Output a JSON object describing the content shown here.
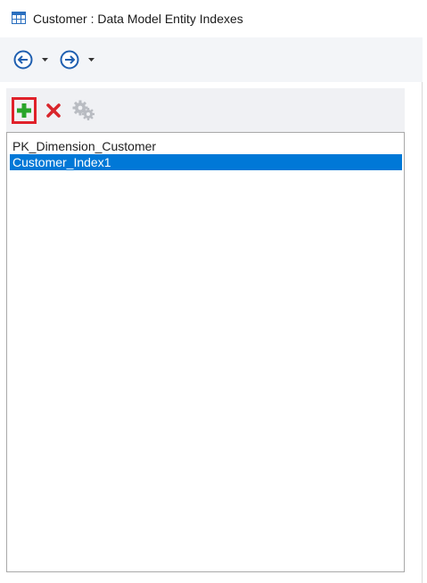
{
  "window": {
    "title": "Customer : Data Model Entity Indexes",
    "title_icon": "table-icon"
  },
  "navigation": {
    "back_icon": "arrow-left-circle-icon",
    "forward_icon": "arrow-right-circle-icon",
    "dropdown_icon": "caret-down-icon"
  },
  "toolbar": {
    "add_icon": "plus-icon",
    "delete_icon": "x-icon",
    "configure_icon": "gears-icon",
    "colors": {
      "add": "#2aa52a",
      "delete": "#d9262c",
      "configure_disabled": "#b9bcc2",
      "highlight_border": "#e0212a"
    }
  },
  "indexes": {
    "items": [
      {
        "label": "PK_Dimension_Customer",
        "selected": false
      },
      {
        "label": "Customer_Index1",
        "selected": true
      }
    ],
    "selection_color": "#0078d7"
  }
}
